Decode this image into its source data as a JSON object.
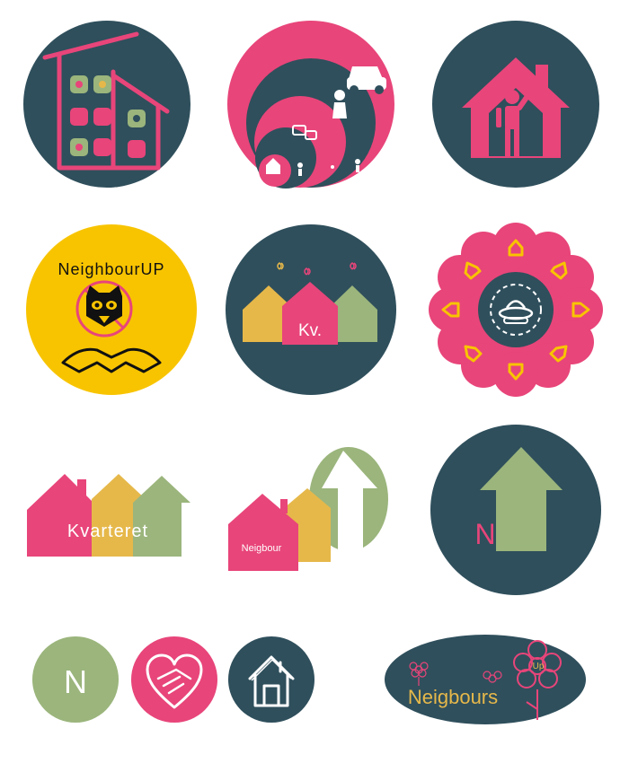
{
  "colors": {
    "navy": "#2f4f5c",
    "pink": "#e8457a",
    "yellow": "#e6b84a",
    "green": "#9bb57c",
    "gold": "#f8c400",
    "white": "#ffffff",
    "black": "#111111"
  },
  "logos": {
    "neighbourup_title": "NeighbourUP",
    "kv_short": "Kv.",
    "kvarteret": "Kvarteret",
    "neigbour": "Neigbour",
    "n_letter_big": "N",
    "n_letter_small": "N",
    "neigbours": "Neigbours",
    "up": "Up"
  },
  "icons": [
    "apartment-building-icon",
    "growth-circles-icon",
    "person-in-house-icon",
    "raccoon-handshake-icon",
    "kv-houses-icon",
    "flower-ufo-icon",
    "kvarteret-houses-icon",
    "neigbour-arrow-icon",
    "n-arrow-icon",
    "n-circle-icon",
    "heart-hands-icon",
    "sketch-house-icon",
    "neigbours-up-flower-icon"
  ]
}
